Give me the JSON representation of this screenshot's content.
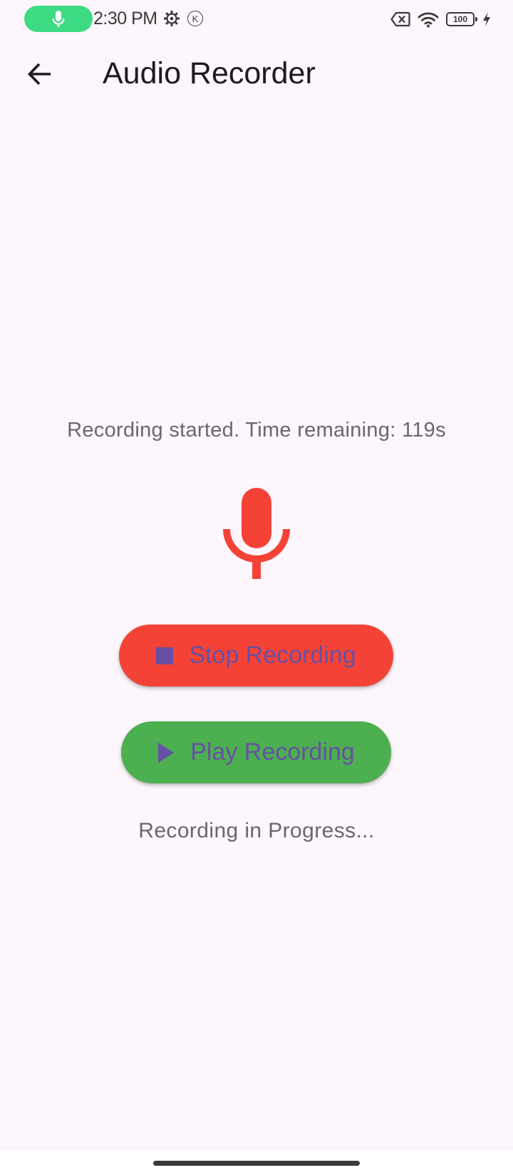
{
  "status_bar": {
    "time": "2:30 PM",
    "k_badge": "K",
    "battery": "100",
    "icons": [
      "mic-icon",
      "settings-gear-icon",
      "k-circle-icon",
      "no-sim-icon",
      "wifi-icon",
      "battery-icon",
      "charging-bolt-icon"
    ],
    "mic_pill_color": "#3DDC84"
  },
  "app_bar": {
    "title": "Audio Recorder",
    "back_icon": "arrow-left-icon"
  },
  "main": {
    "status_message": "Recording started. Time remaining: 119s",
    "mic_icon": "microphone-icon",
    "mic_color": "#F44336",
    "stop_button": {
      "label": "Stop Recording",
      "icon": "stop-square-icon",
      "color": "#F44336"
    },
    "play_button": {
      "label": "Play Recording",
      "icon": "play-triangle-icon",
      "color": "#4CAF50"
    },
    "progress_text": "Recording in Progress..."
  },
  "colors": {
    "background": "#FDF6FC",
    "button_text": "#6750A4",
    "secondary_text": "#6A6570"
  }
}
